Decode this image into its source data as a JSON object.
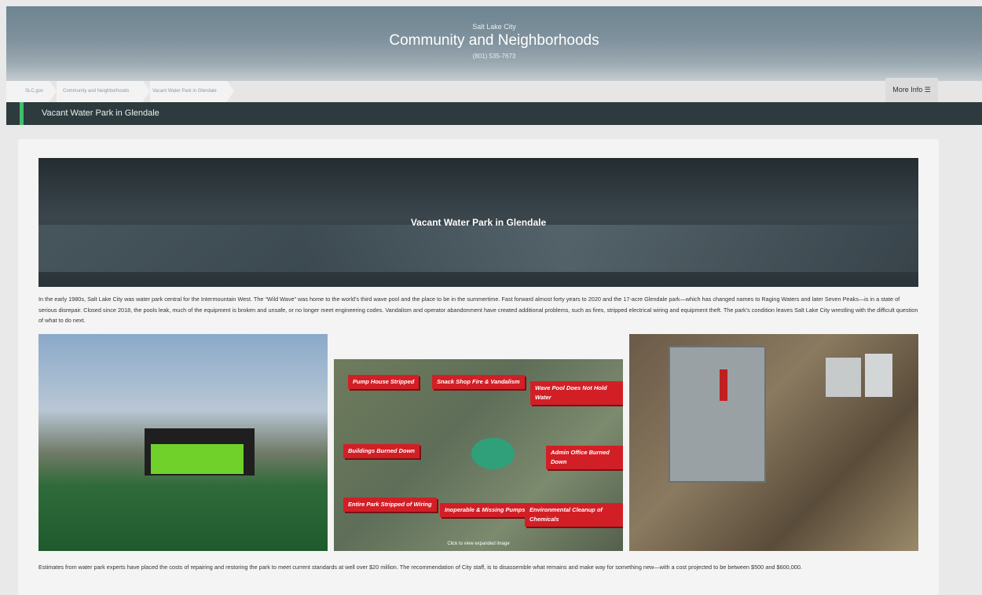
{
  "header": {
    "org": "Salt Lake City",
    "title": "Community and Neighborhoods",
    "phone": "(801) 535-7673"
  },
  "breadcrumb": [
    "SLC.gov",
    "Community and Neighborhoods",
    "Vacant Water Park in Glendale"
  ],
  "more_info": "More Info ☰",
  "page_title": "Vacant Water Park in Glendale",
  "banner_title": "Vacant Water Park in Glendale",
  "intro": "In the early 1980s, Salt Lake City was water park central for the Intermountain West. The “Wild Wave” was home to the world’s third wave pool and the place to be in the summertime. Fast forward almost forty years to 2020 and the 17-acre Glendale park—which has changed names to Raging Waters and later Seven Peaks—is in a state of serious disrepair. Closed since 2018, the pools leak, much of the equipment is broken and unsafe, or no longer meet engineering codes. Vandalism and operator abandonment have created additional problems, such as fires, stripped electrical wiring and equipment theft. The park’s condition leaves Salt Lake City wrestling with the difficult question of what to do next.",
  "map": {
    "labels": [
      "Pump House Stripped",
      "Snack Shop Fire & Vandalism",
      "Wave Pool Does Not Hold Water",
      "Buildings Burned Down",
      "Admin Office Burned Down",
      "Entire Park Stripped of Wiring",
      "Inoperable & Missing Pumps",
      "Environmental Cleanup of Chemicals"
    ],
    "caption": "Click to view expanded image"
  },
  "footer": "Estimates from water park experts have placed the costs of repairing and restoring the park to meet current standards at well over $20 million. The recommendation of City staff, is to disassemble what remains and make way for something new—with a cost projected to be between $500 and $600,000."
}
